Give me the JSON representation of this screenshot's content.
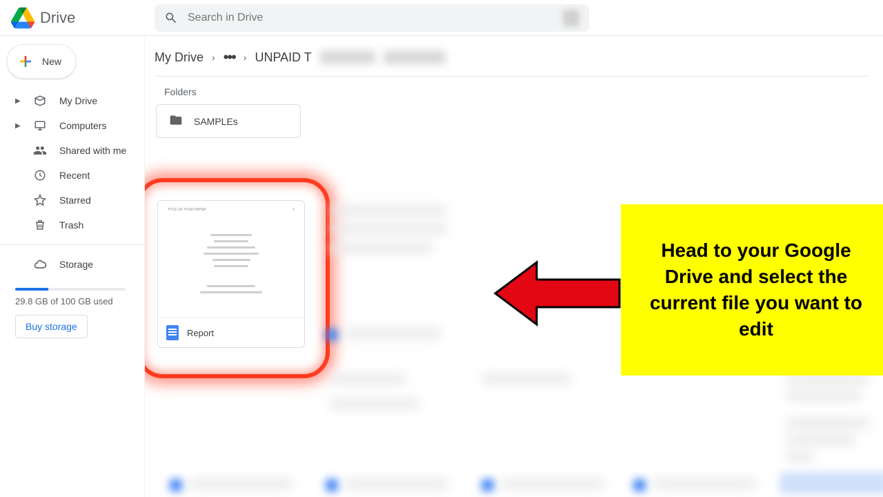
{
  "header": {
    "app_title": "Drive",
    "search_placeholder": "Search in Drive"
  },
  "sidebar": {
    "new_label": "New",
    "items": [
      {
        "label": "My Drive",
        "icon": "drive-icon",
        "has_chev": true
      },
      {
        "label": "Computers",
        "icon": "computers-icon",
        "has_chev": true
      },
      {
        "label": "Shared with me",
        "icon": "shared-icon",
        "has_chev": false
      },
      {
        "label": "Recent",
        "icon": "recent-icon",
        "has_chev": false
      },
      {
        "label": "Starred",
        "icon": "starred-icon",
        "has_chev": false
      },
      {
        "label": "Trash",
        "icon": "trash-icon",
        "has_chev": false
      }
    ],
    "storage_label": "Storage",
    "storage_used_text": "29.8 GB of 100 GB used",
    "buy_storage_label": "Buy storage"
  },
  "main": {
    "breadcrumb": {
      "root": "My Drive",
      "folder": "UNPAID T"
    },
    "folders_label": "Folders",
    "folder_name": "SAMPLEs",
    "file_name": "Report"
  },
  "callout": {
    "text": "Head to your Google Drive and select the current file you want to edit"
  }
}
